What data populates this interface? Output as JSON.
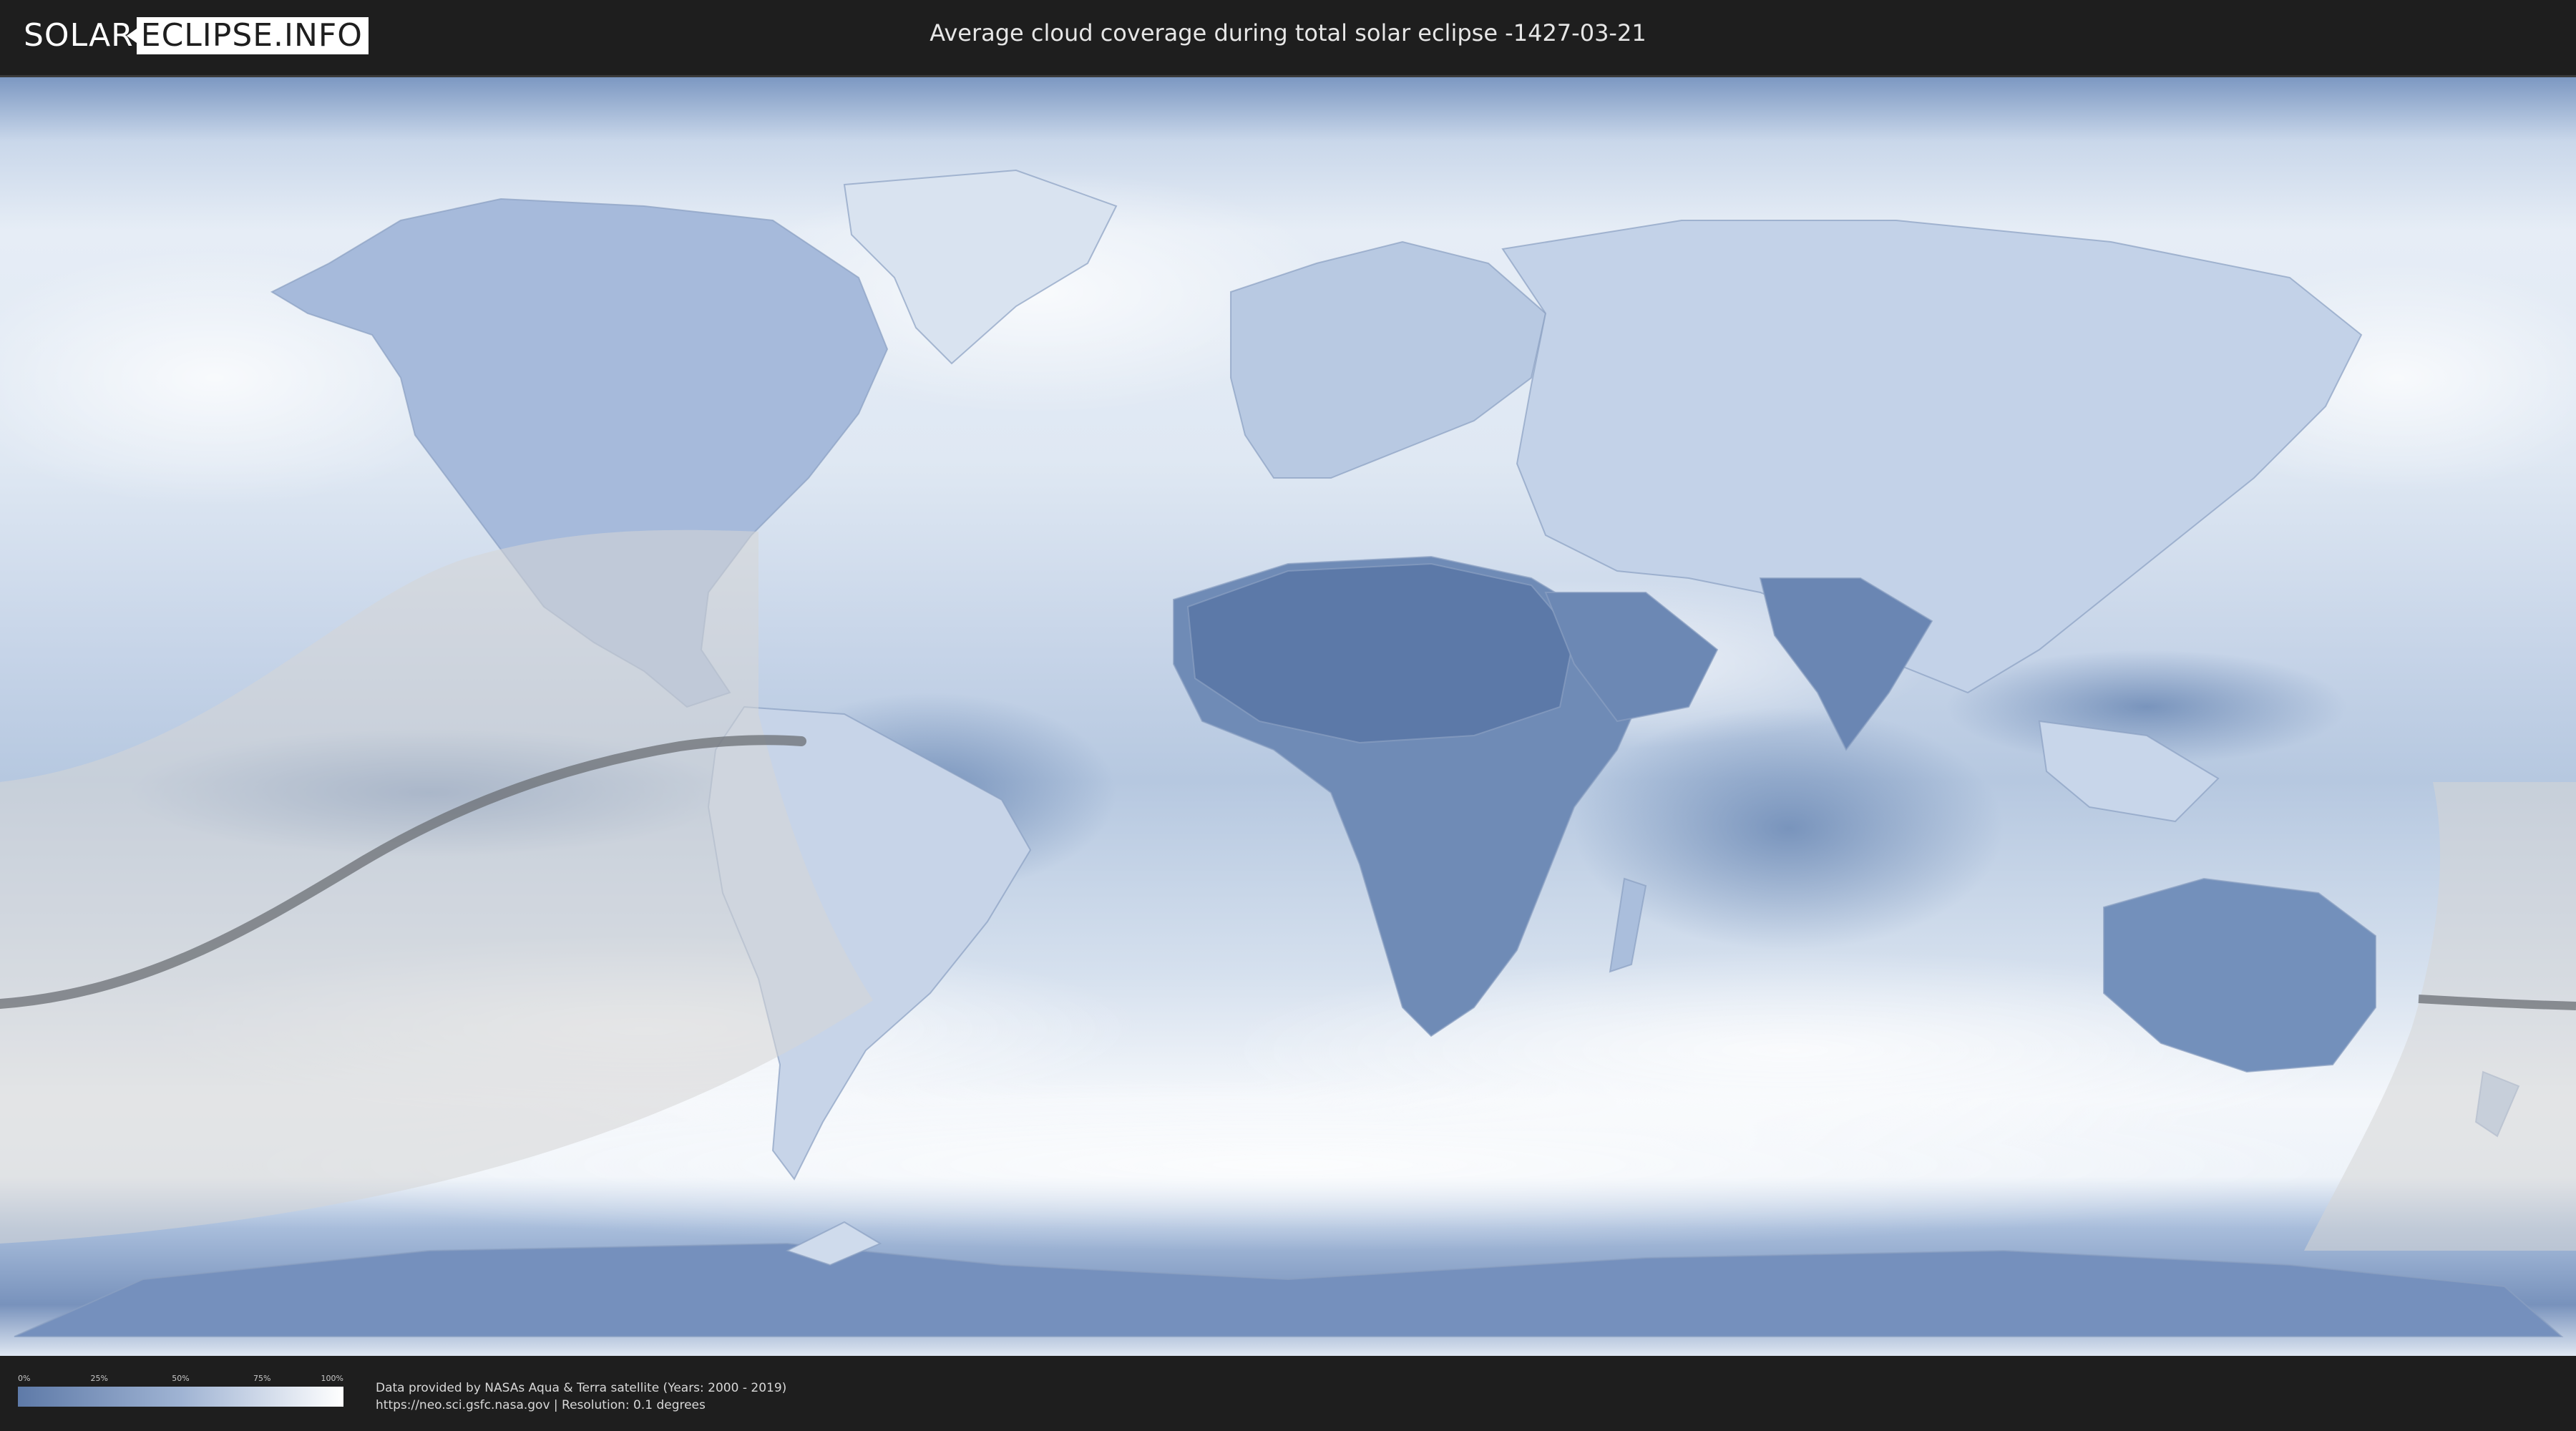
{
  "header": {
    "logo_left": "SOLAR",
    "logo_right": "ECLIPSE.INFO",
    "title": "Average cloud coverage during total solar eclipse -1427-03-21"
  },
  "map": {
    "eclipse_date": "-1427-03-21",
    "colors": {
      "ocean_clear": "#5d7fb0",
      "ocean_cloudy": "#ffffff",
      "land_clear": "#52709f",
      "visibility_overlay": "#d6d6d6",
      "totality_path": "#6b6f74"
    }
  },
  "legend": {
    "ticks": [
      "0%",
      "25%",
      "50%",
      "75%",
      "100%"
    ],
    "gradient_start": "#5e7aa8",
    "gradient_end": "#ffffff"
  },
  "footer": {
    "source": "Data provided by NASAs Aqua & Terra satellite (Years: 2000 - 2019)",
    "url_resolution": "https://neo.sci.gsfc.nasa.gov | Resolution: 0.1 degrees"
  }
}
